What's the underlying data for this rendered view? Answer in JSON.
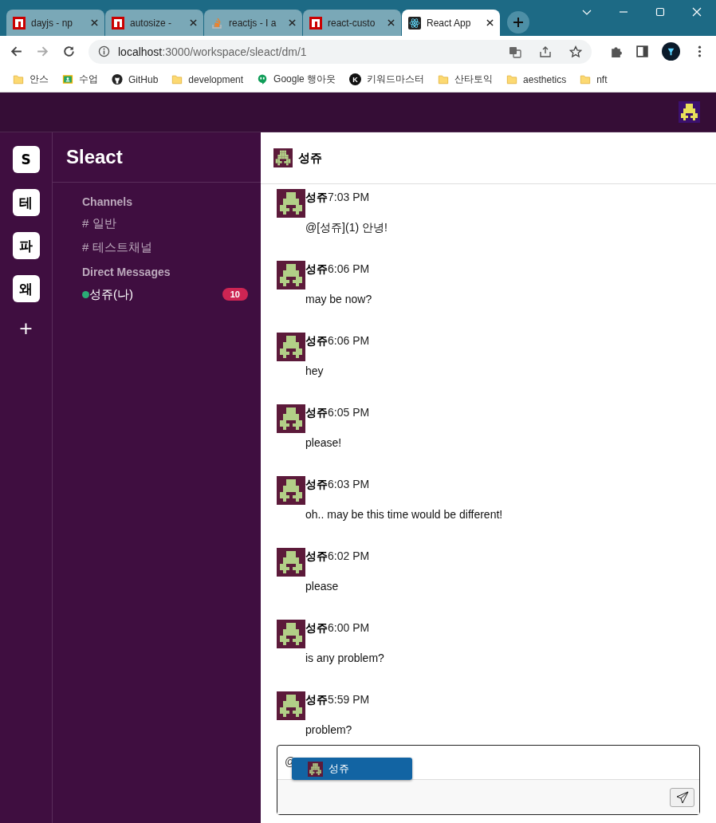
{
  "browser": {
    "tabs": [
      {
        "title": "dayjs - np",
        "kind": "npm",
        "selected": false
      },
      {
        "title": "autosize -",
        "kind": "npm",
        "selected": false
      },
      {
        "title": "reactjs - I a",
        "kind": "stack",
        "selected": false
      },
      {
        "title": "react-custo",
        "kind": "npm",
        "selected": false
      },
      {
        "title": "React App",
        "kind": "react",
        "selected": true
      }
    ],
    "url_host": "localhost",
    "url_path": ":3000/workspace/sleact/dm/1",
    "bookmarks": [
      {
        "label": "안스",
        "kind": "folder"
      },
      {
        "label": "수업",
        "kind": "classroom"
      },
      {
        "label": "GitHub",
        "kind": "github"
      },
      {
        "label": "development",
        "kind": "folder"
      },
      {
        "label": "Google 행아웃",
        "kind": "hangouts"
      },
      {
        "label": "키워드마스터",
        "kind": "letter",
        "icon_text": "K"
      },
      {
        "label": "산타토익",
        "kind": "folder"
      },
      {
        "label": "aesthetics",
        "kind": "folder"
      },
      {
        "label": "nft",
        "kind": "folder"
      }
    ]
  },
  "workspaces": [
    "S",
    "테",
    "파",
    "왜"
  ],
  "add_workspace": "+",
  "workspace_name": "Sleact",
  "channels_heading": "Channels",
  "channels": [
    {
      "name": "# 일반"
    },
    {
      "name": "# 테스트채널"
    }
  ],
  "dm_heading": "Direct Messages",
  "dms": [
    {
      "name": "성쥬(나)",
      "online": true,
      "badge": "10"
    }
  ],
  "chat": {
    "title": "성쥬",
    "messages": [
      {
        "user": "성쥬",
        "time": "7:03 PM",
        "text": "@[성쥬](1) 안녕!"
      },
      {
        "user": "성쥬",
        "time": "6:06 PM",
        "text": "may be now?"
      },
      {
        "user": "성쥬",
        "time": "6:06 PM",
        "text": "hey"
      },
      {
        "user": "성쥬",
        "time": "6:05 PM",
        "text": "please!"
      },
      {
        "user": "성쥬",
        "time": "6:03 PM",
        "text": "oh.. may be this time would be different!"
      },
      {
        "user": "성쥬",
        "time": "6:02 PM",
        "text": "please"
      },
      {
        "user": "성쥬",
        "time": "6:00 PM",
        "text": "is any problem?"
      },
      {
        "user": "성쥬",
        "time": "5:59 PM",
        "text": "problem?"
      }
    ],
    "composer": {
      "value": "@",
      "mentions": [
        {
          "name": "성쥬",
          "selected": true
        }
      ]
    }
  }
}
